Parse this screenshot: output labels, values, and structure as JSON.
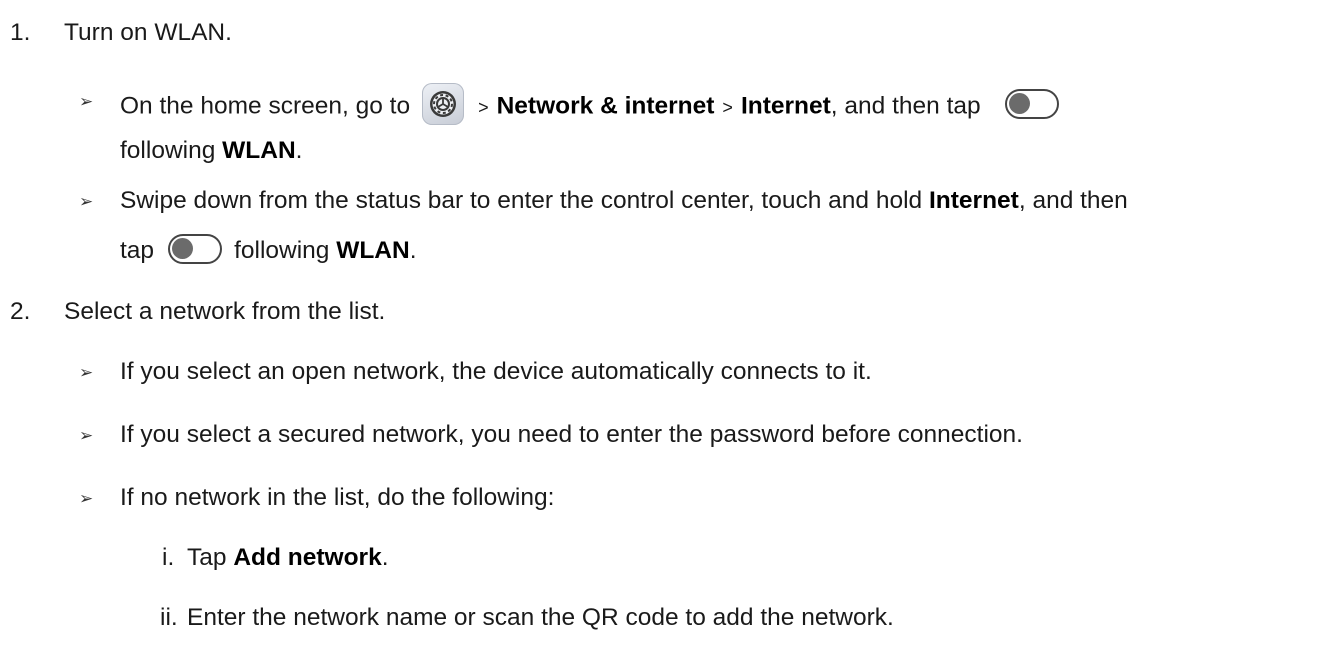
{
  "steps": [
    {
      "number": "1.",
      "text": "Turn on WLAN.",
      "bullets": [
        {
          "p1": "On the home screen, go to",
          "p2": ">",
          "b1": "Network & internet",
          "p3": ">",
          "b2": "Internet",
          "p4": ", and then tap",
          "p5": "following",
          "b3": "WLAN",
          "p6": "."
        },
        {
          "p1": "Swipe down from the status bar to enter the control center, touch and hold",
          "b1": "Internet",
          "p2": ", and then",
          "p3": "tap",
          "p4": "following",
          "b2": "WLAN",
          "p5": "."
        }
      ]
    },
    {
      "number": "2.",
      "text": "Select a network from the list.",
      "bullets": [
        "If you select an open network, the device automatically connects to it.",
        "If you select a secured network, you need to enter the password before connection.",
        "If no network in the list, do the following:"
      ],
      "substeps": [
        {
          "number": "i.",
          "pre": "Tap",
          "bold": "Add network",
          "post": "."
        },
        {
          "number": "ii.",
          "text": "Enter the network name or scan the QR code to add the network."
        }
      ]
    }
  ],
  "bullet_glyph": "➢",
  "icons": [
    "settings-gear-icon",
    "toggle-switch-off-icon"
  ]
}
